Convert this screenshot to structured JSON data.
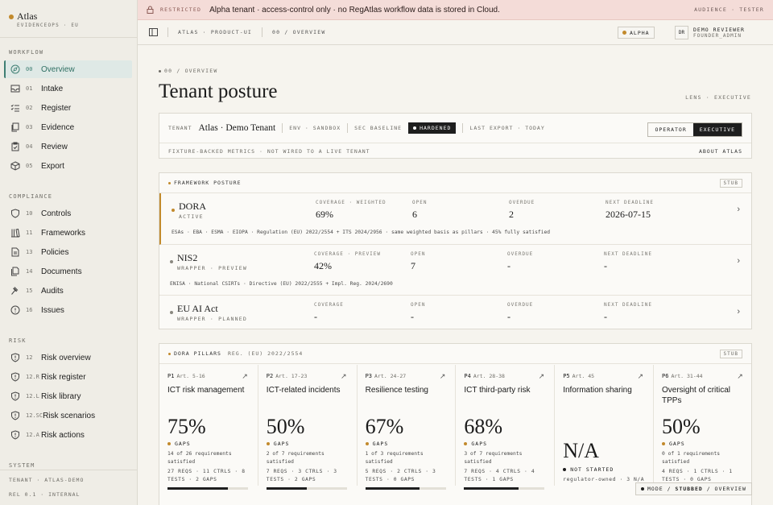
{
  "app": {
    "name": "Atlas",
    "sub": "EVIDENCEOPS · EU"
  },
  "sidebar": {
    "workflow_title": "WORKFLOW",
    "workflow": [
      {
        "num": "00",
        "label": "Overview",
        "icon": "compass-icon"
      },
      {
        "num": "01",
        "label": "Intake",
        "icon": "inbox-icon"
      },
      {
        "num": "02",
        "label": "Register",
        "icon": "list-check-icon"
      },
      {
        "num": "03",
        "label": "Evidence",
        "icon": "files-icon"
      },
      {
        "num": "04",
        "label": "Review",
        "icon": "clipboard-check-icon"
      },
      {
        "num": "05",
        "label": "Export",
        "icon": "package-icon"
      }
    ],
    "compliance_title": "COMPLIANCE",
    "compliance": [
      {
        "num": "10",
        "label": "Controls",
        "icon": "shield-icon"
      },
      {
        "num": "11",
        "label": "Frameworks",
        "icon": "library-icon"
      },
      {
        "num": "13",
        "label": "Policies",
        "icon": "document-icon"
      },
      {
        "num": "14",
        "label": "Documents",
        "icon": "documents-icon"
      },
      {
        "num": "15",
        "label": "Audits",
        "icon": "gavel-icon"
      },
      {
        "num": "16",
        "label": "Issues",
        "icon": "alert-circle-icon"
      }
    ],
    "risk_title": "RISK",
    "risk": [
      {
        "num": "12",
        "label": "Risk overview",
        "icon": "shield-alert-icon"
      },
      {
        "num": "12.R",
        "label": "Risk register",
        "icon": "shield-alert-icon"
      },
      {
        "num": "12.L",
        "label": "Risk library",
        "icon": "shield-alert-icon"
      },
      {
        "num": "12.SC",
        "label": "Risk scenarios",
        "icon": "shield-alert-icon"
      },
      {
        "num": "12.A",
        "label": "Risk actions",
        "icon": "shield-alert-icon"
      }
    ],
    "system_title": "SYSTEM",
    "tenant_line": "TENANT · ATLAS-DEMO",
    "release_line": "REL 0.1 · INTERNAL"
  },
  "banner": {
    "tag": "RESTRICTED",
    "message": "Alpha tenant · access-control only · no RegAtlas workflow data is stored in Cloud.",
    "audience": "AUDIENCE · TESTER"
  },
  "topbar": {
    "crumb_app": "ATLAS · PRODUCT-UI",
    "crumb_page": "00 / OVERVIEW",
    "alpha_badge": "ALPHA",
    "avatar": "DR",
    "user_name": "DEMO REVIEWER",
    "user_role": "FOUNDER_ADMIN"
  },
  "page": {
    "kicker": "00 / OVERVIEW",
    "title": "Tenant posture",
    "lens": "LENS · EXECUTIVE"
  },
  "tenant": {
    "label": "TENANT",
    "name": "Atlas · Demo Tenant",
    "env": "ENV · SANDBOX",
    "baseline_label": "SEC BASELINE",
    "baseline_value": "HARDENED",
    "last_export": "LAST EXPORT · TODAY",
    "lens_operator": "OPERATOR",
    "lens_executive": "EXECUTIVE",
    "note": "FIXTURE-BACKED METRICS · NOT WIRED TO A LIVE TENANT",
    "about": "ABOUT ATLAS"
  },
  "framework_posture": {
    "title": "FRAMEWORK POSTURE",
    "stub": "STUB",
    "rows": [
      {
        "name": "DORA",
        "status": "ACTIVE",
        "dot": "#c28a2c",
        "coverage_label": "COVERAGE · WEIGHTED",
        "coverage": "69%",
        "open_label": "OPEN",
        "open": "6",
        "overdue_label": "OVERDUE",
        "overdue": "2",
        "deadline_label": "NEXT DEADLINE",
        "deadline": "2026-07-15",
        "note": "ESAs · EBA · ESMA · EIOPA · Regulation (EU) 2022/2554 + ITS 2024/2956 · same weighted basis as pillars · 45% fully satisfied"
      },
      {
        "name": "NIS2",
        "status": "WRAPPER · PREVIEW",
        "dot": "#8a8880",
        "coverage_label": "COVERAGE · PREVIEW",
        "coverage": "42%",
        "open_label": "OPEN",
        "open": "7",
        "overdue_label": "OVERDUE",
        "overdue": "-",
        "deadline_label": "NEXT DEADLINE",
        "deadline": "-",
        "note": "ENISA · National CSIRTs · Directive (EU) 2022/2555 + Impl. Reg. 2024/2690"
      },
      {
        "name": "EU AI Act",
        "status": "WRAPPER · PLANNED",
        "dot": "#8a8880",
        "coverage_label": "COVERAGE",
        "coverage": "-",
        "open_label": "OPEN",
        "open": "-",
        "overdue_label": "OVERDUE",
        "overdue": "-",
        "deadline_label": "NEXT DEADLINE",
        "deadline": "-",
        "note": ""
      }
    ]
  },
  "pillars": {
    "title": "DORA PILLARS",
    "reg": "REG. (EU) 2022/2554",
    "stub": "STUB",
    "items": [
      {
        "id": "P1",
        "art": "Art. 5-16",
        "name": "ICT risk management",
        "pct": "75%",
        "progress": 0.75,
        "status": "GAPS",
        "detail": "14 of 26 requirements satisfied",
        "counts": "27 REQS · 11 CTRLS · 8 TESTS · 2 GAPS"
      },
      {
        "id": "P2",
        "art": "Art. 17-23",
        "name": "ICT-related incidents",
        "pct": "50%",
        "progress": 0.5,
        "status": "GAPS",
        "detail": "2 of 7 requirements satisfied",
        "counts": "7 REQS · 3 CTRLS · 3 TESTS · 2 GAPS"
      },
      {
        "id": "P3",
        "art": "Art. 24-27",
        "name": "Resilience testing",
        "pct": "67%",
        "progress": 0.67,
        "status": "GAPS",
        "detail": "1 of 3 requirements satisfied",
        "counts": "5 REQS · 2 CTRLS · 3 TESTS · 0 GAPS"
      },
      {
        "id": "P4",
        "art": "Art. 28-38",
        "name": "ICT third-party risk",
        "pct": "68%",
        "progress": 0.68,
        "status": "GAPS",
        "detail": "3 of 7 requirements satisfied",
        "counts": "7 REQS · 4 CTRLS · 4 TESTS · 1 GAPS"
      },
      {
        "id": "P5",
        "art": "Art. 45",
        "name": "Information sharing",
        "pct": "N/A",
        "progress": 0,
        "status": "NOT STARTED",
        "detail": "",
        "counts": "regulator-owned · 3 N/A"
      },
      {
        "id": "P6",
        "art": "Art. 31-44",
        "name": "Oversight of critical TPPs",
        "pct": "50%",
        "progress": 0.5,
        "status": "GAPS",
        "detail": "0 of 1 requirements satisfied",
        "counts": "4 REQS · 1 CTRLS · 1 TESTS · 0 GAPS"
      }
    ]
  },
  "mode_pill": {
    "prefix": "MODE /",
    "mode": "STUBBED",
    "page": "/ OVERVIEW"
  }
}
